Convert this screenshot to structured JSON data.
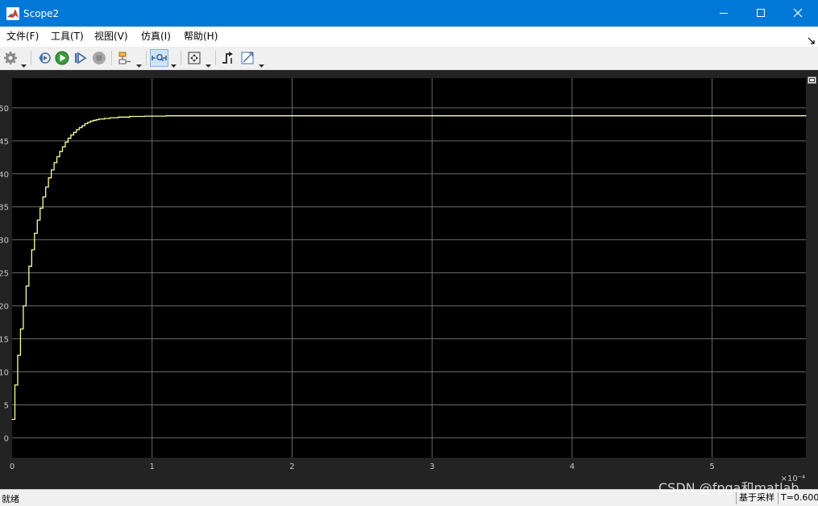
{
  "window": {
    "title": "Scope2"
  },
  "menu": [
    "文件(F)",
    "工具(T)",
    "视图(V)",
    "仿真(I)",
    "帮助(H)"
  ],
  "toolbar": [
    {
      "icon": "settings-icon"
    },
    {
      "icon": "step-back-icon"
    },
    {
      "icon": "run-icon"
    },
    {
      "icon": "step-forward-icon"
    },
    {
      "icon": "stop-icon"
    },
    {
      "icon": "highlight-block-icon"
    },
    {
      "icon": "zoom-icon",
      "active": true
    },
    {
      "icon": "autoscale-icon"
    },
    {
      "icon": "triggers-icon"
    },
    {
      "icon": "cursor-measurements-icon"
    }
  ],
  "colors": {
    "titlebar": "#0078d7",
    "plot_bg": "#000000",
    "frame_bg": "#232323",
    "trace": "#ffff96",
    "grid": "#6a6a6a",
    "axis_text": "#c8c8c8"
  },
  "chart_data": {
    "type": "line",
    "title": "",
    "xlabel": "",
    "ylabel": "",
    "x_exponent_label": "×10⁻⁴",
    "xlim": [
      0,
      5.67
    ],
    "ylim": [
      -3,
      54.5
    ],
    "xticks": [
      0,
      1,
      2,
      3,
      4,
      5
    ],
    "yticks": [
      0,
      5,
      10,
      15,
      20,
      25,
      30,
      35,
      40,
      45,
      50
    ],
    "grid": true,
    "stairs": true,
    "series": [
      {
        "values": [
          {
            "x": 0,
            "y": 2.8
          },
          {
            "x": 0.02,
            "y": 8.0
          },
          {
            "x": 0.04,
            "y": 12.5
          },
          {
            "x": 0.06,
            "y": 16.5
          },
          {
            "x": 0.08,
            "y": 20.0
          },
          {
            "x": 0.1,
            "y": 23.0
          },
          {
            "x": 0.12,
            "y": 26.0
          },
          {
            "x": 0.14,
            "y": 28.5
          },
          {
            "x": 0.16,
            "y": 31.0
          },
          {
            "x": 0.18,
            "y": 33.0
          },
          {
            "x": 0.2,
            "y": 34.8
          },
          {
            "x": 0.22,
            "y": 36.5
          },
          {
            "x": 0.24,
            "y": 38.0
          },
          {
            "x": 0.26,
            "y": 39.4
          },
          {
            "x": 0.28,
            "y": 40.6
          },
          {
            "x": 0.3,
            "y": 41.7
          },
          {
            "x": 0.32,
            "y": 42.6
          },
          {
            "x": 0.34,
            "y": 43.4
          },
          {
            "x": 0.36,
            "y": 44.1
          },
          {
            "x": 0.38,
            "y": 44.8
          },
          {
            "x": 0.4,
            "y": 45.4
          },
          {
            "x": 0.42,
            "y": 45.9
          },
          {
            "x": 0.44,
            "y": 46.3
          },
          {
            "x": 0.46,
            "y": 46.7
          },
          {
            "x": 0.48,
            "y": 47.0
          },
          {
            "x": 0.5,
            "y": 47.3
          },
          {
            "x": 0.52,
            "y": 47.6
          },
          {
            "x": 0.54,
            "y": 47.8
          },
          {
            "x": 0.56,
            "y": 48.0
          },
          {
            "x": 0.58,
            "y": 48.1
          },
          {
            "x": 0.6,
            "y": 48.2
          },
          {
            "x": 0.62,
            "y": 48.3
          },
          {
            "x": 0.66,
            "y": 48.4
          },
          {
            "x": 0.7,
            "y": 48.5
          },
          {
            "x": 0.76,
            "y": 48.6
          },
          {
            "x": 0.84,
            "y": 48.7
          },
          {
            "x": 0.95,
            "y": 48.75
          },
          {
            "x": 1.1,
            "y": 48.8
          },
          {
            "x": 5.67,
            "y": 48.8
          }
        ]
      }
    ]
  },
  "status": {
    "left": "就绪",
    "mode": "基于采样",
    "time": "T=0.600"
  },
  "watermark": "CSDN @fpga和matlab"
}
